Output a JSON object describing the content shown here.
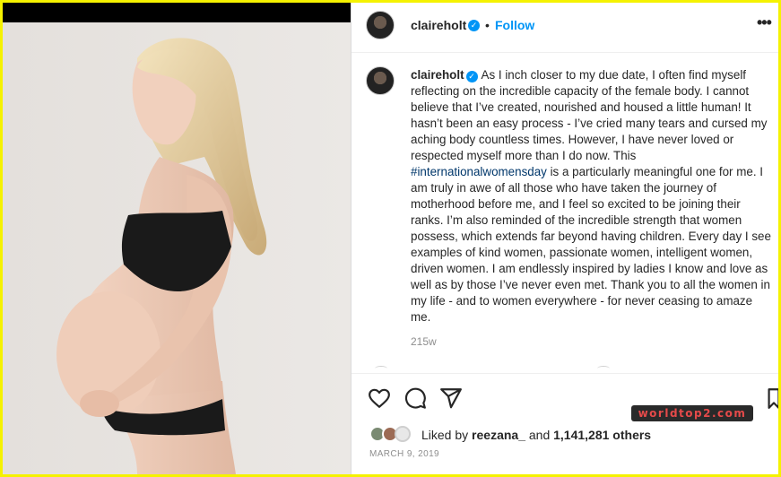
{
  "post": {
    "username": "claireholt",
    "follow_label": "Follow",
    "separator": "•",
    "more_label": "•••",
    "verified_mark": "✓"
  },
  "caption": {
    "username": "claireholt",
    "text_before_hashtag": "As I inch closer to my due date, I often find myself reflecting on the incredible capacity of the female body. I cannot believe that I’ve created, nourished and housed a little human! It hasn’t been an easy process - I’ve cried many tears and cursed my aching body countless times. However, I have never loved or respected myself more than I do now. This ",
    "hashtag": "#internationalwomensday",
    "text_after_hashtag": " is a particularly meaningful one for me. I am truly in awe of all those who have taken the journey of motherhood before me, and I feel so excited to be joining their ranks. I’m also reminded of the incredible strength that women possess, which extends far beyond having children. Every day I see examples of kind women, passionate women, intelligent women, driven women. I am endlessly inspired by ladies I know and love as well as by those I’ve never even met. Thank you to all the women in my life - and to women everywhere - for never ceasing to amaze me.",
    "time_ago": "215w"
  },
  "actions": {
    "icons": [
      "heart-icon",
      "comment-icon",
      "share-icon",
      "bookmark-icon"
    ]
  },
  "likes": {
    "prefix": "Liked by ",
    "user": "reezana_",
    "middle": " and ",
    "count": "1,141,281 others"
  },
  "date": "MARCH 9, 2019",
  "watermark": "worldtop2.com",
  "colors": {
    "accent": "#0095f6",
    "hashtag": "#00376b",
    "frame": "#f5f200",
    "text": "#262626",
    "muted": "#8e8e8e"
  }
}
